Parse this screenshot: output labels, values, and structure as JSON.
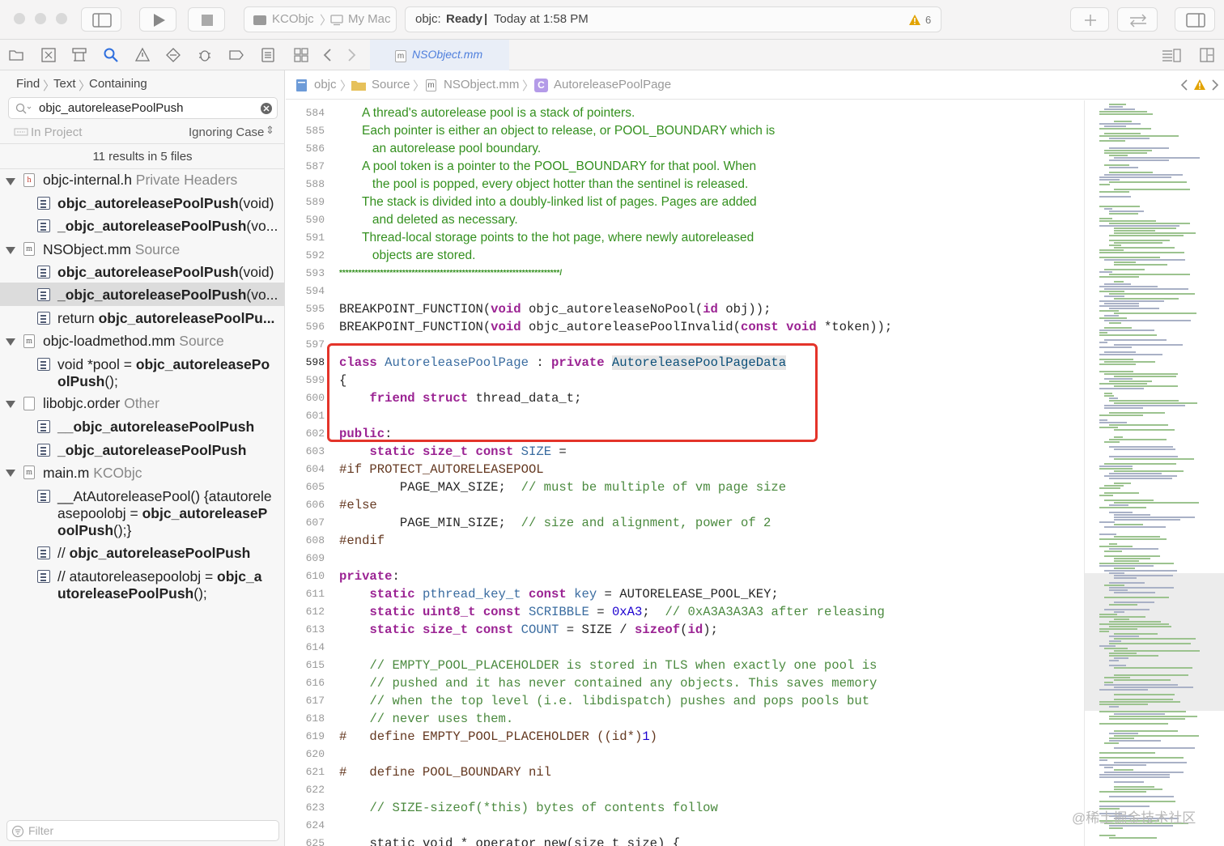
{
  "toolbar": {
    "scheme_project": "KCObjc",
    "scheme_target": "My Mac",
    "status_prefix": "objc:",
    "status_state": "Ready",
    "status_time": "Today at 1:58 PM",
    "warning_count": "6"
  },
  "tab": {
    "filename": "NSObject.mm"
  },
  "find": {
    "breadcrumb": [
      "Find",
      "Text",
      "Containing"
    ],
    "query": "objc_autoreleasePoolPush",
    "scope": "In Project",
    "case_mode": "Ignoring Case",
    "summary": "11 results in 5 files",
    "filter_placeholder": "Filter"
  },
  "results": {
    "groups": [
      {
        "file": "objc-internal.h",
        "kind": "Private Headers",
        "icon": "h"
      },
      {
        "file": "NSObject.mm",
        "kind": "Source",
        "icon": "m"
      },
      {
        "file": "objc-loadmethod.mm",
        "kind": "Source",
        "icon": "m"
      },
      {
        "file": "libobjc.order",
        "kind": "Other",
        "icon": ""
      },
      {
        "file": "main.m",
        "kind": "KCObjc",
        "icon": "m"
      }
    ],
    "items": [
      {
        "pre": "",
        "match": "objc_autoreleasePoolPush",
        "post": "(void)"
      },
      {
        "pre": "",
        "match": "_objc_autoreleasePoolPush",
        "post": "(vo..."
      },
      {
        "pre": "",
        "match": "objc_autoreleasePoolPush",
        "post": "(void)"
      },
      {
        "pre": "",
        "match": "_objc_autoreleasePoolPush",
        "post": "(vo..."
      },
      {
        "pre": "return ",
        "match": "objc_autoreleasePoolPu...",
        "post": ""
      },
      {
        "l1_pre": "void *pool = ",
        "l1_match": "objc_autoreleasePo",
        "l2_match": "olPush",
        "l2_post": "();"
      },
      {
        "pre": "",
        "match": "__objc_autoreleasePoolPush",
        "post": ""
      },
      {
        "pre": "",
        "match": "_objc_autoreleasePoolPush",
        "post": ""
      },
      {
        "l1_pre": "__AtAutoreleasePool() {atautorele",
        "l2_pre": "asepoolobj = ",
        "l2_match": "objc_autoreleaseP",
        "l3_match": "oolPush",
        "l3_post": "();}"
      },
      {
        "pre": "// ",
        "match": "objc_autoreleasePoolPush",
        "post": ""
      },
      {
        "l1_pre": "// atautoreleasepoolobj = ",
        "l1_match": "objc_a",
        "l2_match": "utoreleasePoolPush",
        "l2_post": "();"
      }
    ]
  },
  "jumpbar": [
    "objc",
    "Source",
    "NSObject.mm",
    "AutoreleasePoolPage"
  ],
  "editor": {
    "line_numbers": [
      "584",
      "585",
      "586",
      "587",
      "588",
      "589",
      "590",
      "591",
      "592",
      "593",
      "594",
      "595",
      "596",
      "597",
      "598",
      "599",
      "600",
      "601",
      "602",
      "603",
      "604",
      "605",
      "606",
      "607",
      "608",
      "609",
      "610",
      "611",
      "612",
      "613",
      "614",
      "615",
      "616",
      "617",
      "618",
      "619",
      "620",
      "621",
      "622",
      "623",
      "624",
      "625"
    ],
    "doc_lines": [
      "A thread's autorelease pool is a stack of pointers.",
      "Each pointer is either an object to release, or POOL_BOUNDARY which is",
      "   an autorelease pool boundary.",
      "A pool token is a pointer to the POOL_BOUNDARY for that pool. When",
      "   the pool is popped, every object hotter than the sentinel is released.",
      "The stack is divided into a doubly-linked list of pages. Pages are added",
      "   and deleted as necessary.",
      "Thread-local storage points to the hot page, where newly autoreleased",
      "   objects are stored."
    ],
    "stars": "**********************************************************************/",
    "code": {
      "l595_macro": "BREAKPOINT_FUNCTION",
      "l595_rest": " objc_autoreleaseNoPool(",
      "l595_tail": " obj));",
      "l596_rest": " objc_autoreleasePoolInvalid(",
      "l596_tail": " *token));",
      "kw_void": "void",
      "kw_id": "id",
      "kw_const": "const",
      "kw_class": "class",
      "class_name": "AutoreleasePoolPage",
      "colon": " : ",
      "kw_private": "private",
      "base_class": "AutoreleasePoolPageData",
      "brace_open": "{",
      "kw_friend": "friend",
      "kw_struct": "struct",
      "thread_data": " thread_data_t;",
      "kw_public": "public",
      "colon_only": ":",
      "kw_static": "static",
      "size_t": "size_t",
      "SIZE": "SIZE",
      "eq": " =",
      "if_prot": "#if PROTECT_AUTORELEASEPOOL",
      "max_size": "PAGE_MAX_SIZE;",
      "cm_max": "// must be multiple of vm page size",
      "else": "#else",
      "min_size": "PAGE_MIN_SIZE;",
      "cm_min": "// size and alignment, power of 2",
      "endif": "#endif",
      "pthread": "pthread_key_t",
      "key": "key",
      "key_val": " = AUTORELEASE_POOL_KEY;",
      "uint8": "uint8_t",
      "scribble": "SCRIBBLE",
      "hex": "0xA3",
      "cm_scribble": "// 0xA3A3A3A3 after releasing",
      "count": "COUNT",
      "count_expr": " = SIZE / ",
      "sizeof": "sizeof",
      "comments": [
        "// EMPTY_POOL_PLACEHOLDER is stored in TLS when exactly one pool is",
        "// pushed and it has never contained any objects. This saves memory",
        "// when the top level (i.e. libdispatch) pushes and pops pools but",
        "// never uses them."
      ],
      "define1": "#   define EMPTY_POOL_PLACEHOLDER ((id*)",
      "one": "1",
      "close_paren": ")",
      "define2": "#   define POOL_BOUNDARY nil",
      "cm_size": "// SIZE-sizeof(*this) bytes of contents follow",
      "l625": "static void * operator new(size_t size) {"
    }
  },
  "watermark": "@稀土掘金技术社区",
  "colors": {
    "keyword": "#9b2393",
    "type": "#3a6ca0",
    "comment": "#4b8a3f",
    "doc_comment": "#34901f",
    "number": "#1c00cf",
    "highlight_box": "#e4342a",
    "accent": "#4f7fdc"
  }
}
